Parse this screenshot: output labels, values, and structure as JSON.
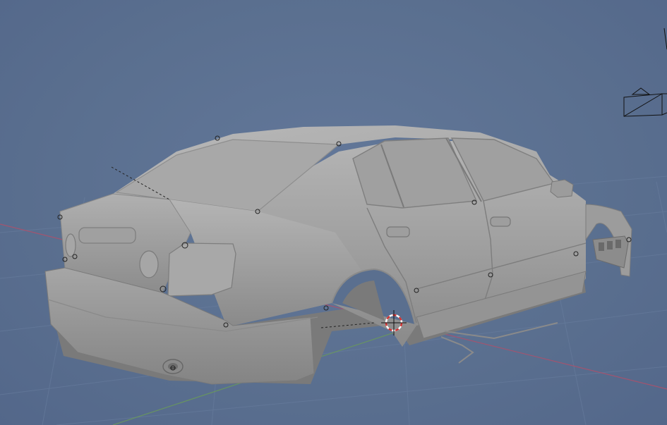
{
  "viewport": {
    "name": "3d-viewport",
    "background_color": "#5a6f8f",
    "grid_color": "#6a7fa0",
    "axis_x_color": "#b0506a",
    "axis_y_color": "#6a9a5a",
    "model_color": "#9a9a9a",
    "model_shadow_color": "#6e6e6e",
    "model_highlight_color": "#c4c4c4",
    "cursor_colors": [
      "#d03030",
      "#ffffff"
    ],
    "camera_color": "#111111"
  },
  "objects": {
    "model": "car-body-model",
    "camera": "camera-object",
    "cursor": "3d-cursor-icon"
  }
}
